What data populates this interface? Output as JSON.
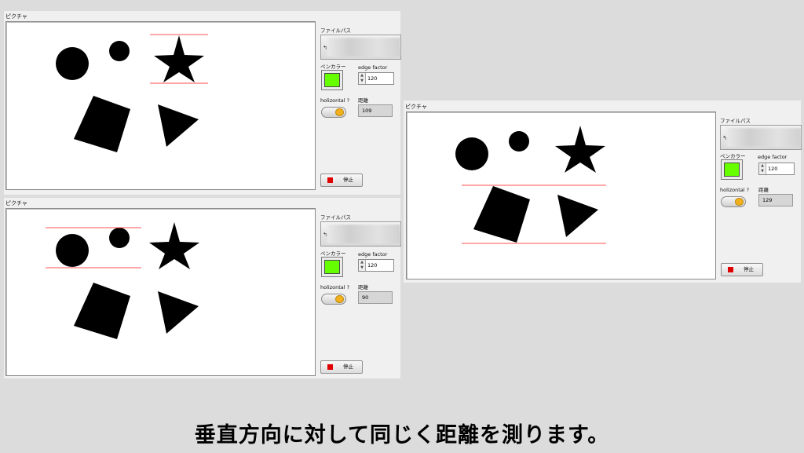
{
  "panels": [
    {
      "picture_label": "ピクチャ",
      "file_path_label": "ファイルパス",
      "pen_color_label": "ペンカラー",
      "pen_color": "#66ff00",
      "edge_factor_label": "edge factor",
      "edge_factor_value": "120",
      "horizontal_label": "holizontal ?",
      "distance_label": "距離",
      "distance_value": "109",
      "stop_label": "停止"
    },
    {
      "picture_label": "ピクチャ",
      "file_path_label": "ファイルパス",
      "pen_color_label": "ペンカラー",
      "pen_color": "#66ff00",
      "edge_factor_label": "edge factor",
      "edge_factor_value": "120",
      "horizontal_label": "holizontal ?",
      "distance_label": "距離",
      "distance_value": "90",
      "stop_label": "停止"
    },
    {
      "picture_label": "ピクチャ",
      "file_path_label": "ファイルパス",
      "pen_color_label": "ペンカラー",
      "pen_color": "#66ff00",
      "edge_factor_label": "edge factor",
      "edge_factor_value": "120",
      "horizontal_label": "holizontal ?",
      "distance_label": "距離",
      "distance_value": "129",
      "stop_label": "停止"
    }
  ],
  "measure_line_color": "#ff5050",
  "stop_color": "#e00000",
  "caption": "垂直方向に対して同じく距離を測ります。"
}
